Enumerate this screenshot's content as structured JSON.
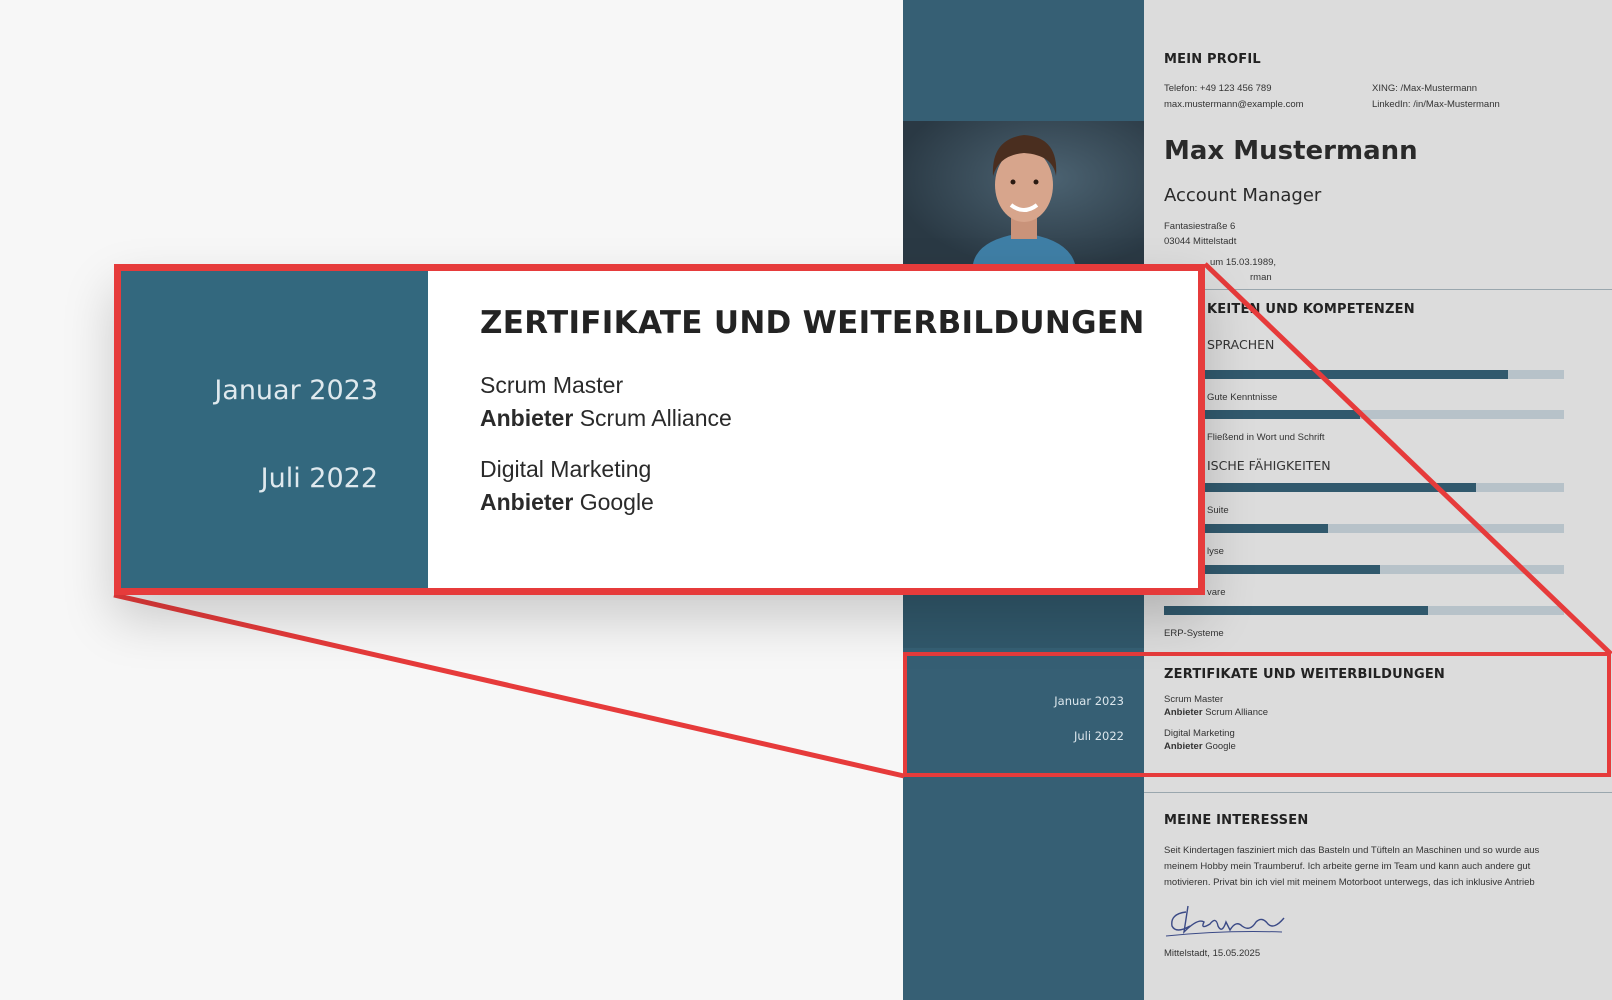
{
  "profile": {
    "heading": "MEIN PROFIL",
    "phone": "Telefon: +49 123 456 789",
    "email": "max.mustermann@example.com",
    "xing": "XING: /Max-Mustermann",
    "linkedin": "LinkedIn: /in/Max-Mustermann",
    "name": "Max Mustermann",
    "role": "Account Manager",
    "street": "Fantasiestraße 6",
    "city": "03044 Mittelstadt",
    "born_fragment": "um 15.03.1989,",
    "born_place_fragment": "rman"
  },
  "skills": {
    "heading_fragment": "KEITEN UND KOMPETENZEN",
    "languages_fragment": "SPRACHEN",
    "technical_fragment": "ISCHE FÄHIGKEITEN",
    "language_bars": [
      {
        "label": "",
        "level": 0.86
      },
      {
        "label": "Gute Kenntnisse",
        "level": 0.49
      },
      {
        "label": "Fließend in Wort und Schrift",
        "level": 0
      }
    ],
    "tech_bars": [
      {
        "label": "",
        "level": 0.78
      },
      {
        "label": "Suite",
        "level": 0.41
      },
      {
        "label": "lyse",
        "level": 0.54
      },
      {
        "label": "vare",
        "level": 0.66
      },
      {
        "label": "ERP-Systeme",
        "level": 0
      }
    ]
  },
  "certificates": {
    "heading": "ZERTIFIKATE UND WEITERBILDUNGEN",
    "items": [
      {
        "date": "Januar 2023",
        "title": "Scrum Master",
        "provider_label": "Anbieter",
        "provider": "Scrum Alliance"
      },
      {
        "date": "Juli 2022",
        "title": "Digital Marketing",
        "provider_label": "Anbieter",
        "provider": "Google"
      }
    ]
  },
  "interests": {
    "heading": "MEINE INTERESSEN",
    "line1": "Seit Kindertagen fasziniert mich das Basteln und Tüfteln an Maschinen und so wurde aus",
    "line2": "meinem Hobby mein Traumberuf. Ich arbeite gerne im Team und kann auch andere gut",
    "line3": "motivieren. Privat bin ich viel mit meinem Motorboot unterwegs, das ich inklusive Antrieb",
    "place_date": "Mittelstadt, 15.05.2025"
  },
  "colors": {
    "sidebar": "#365f74",
    "accent_bar": "#31596d",
    "highlight": "#e63b3b"
  }
}
